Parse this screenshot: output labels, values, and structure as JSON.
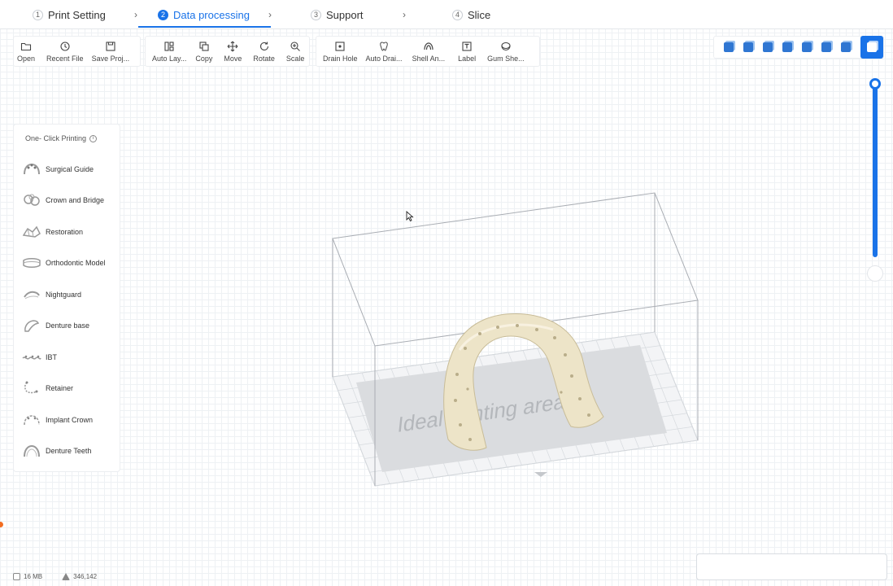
{
  "steps": [
    {
      "num": "1",
      "label": "Print Setting"
    },
    {
      "num": "2",
      "label": "Data processing"
    },
    {
      "num": "3",
      "label": "Support"
    },
    {
      "num": "4",
      "label": "Slice"
    }
  ],
  "active_step": 2,
  "chevron": "›",
  "toolbar": {
    "file": [
      {
        "label": "Open",
        "icon": "folder-icon"
      },
      {
        "label": "Recent File",
        "icon": "clock-icon"
      },
      {
        "label": "Save Proj...",
        "icon": "save-icon"
      }
    ],
    "edit": [
      {
        "label": "Auto Lay...",
        "icon": "layout-icon"
      },
      {
        "label": "Copy",
        "icon": "copy-icon"
      },
      {
        "label": "Move",
        "icon": "move-icon"
      },
      {
        "label": "Rotate",
        "icon": "rotate-icon"
      },
      {
        "label": "Scale",
        "icon": "scale-icon"
      }
    ],
    "tools": [
      {
        "label": "Drain Hole",
        "icon": "drain-hole-icon"
      },
      {
        "label": "Auto Drai...",
        "icon": "tooth-icon"
      },
      {
        "label": "Shell An...",
        "icon": "shell-icon"
      },
      {
        "label": "Label",
        "icon": "text-label-icon"
      },
      {
        "label": "Gum She...",
        "icon": "gum-icon"
      }
    ]
  },
  "views": [
    "view-iso-icon",
    "view-front-icon",
    "view-back-icon",
    "view-left-icon",
    "view-right-icon",
    "view-top-icon",
    "view-bottom-icon"
  ],
  "panel": {
    "title": "One- Click Printing",
    "info": "i",
    "items": [
      {
        "label": "Surgical Guide",
        "icon": "surgical-guide-icon"
      },
      {
        "label": "Crown and Bridge",
        "icon": "crown-bridge-icon"
      },
      {
        "label": "Restoration",
        "icon": "restoration-icon"
      },
      {
        "label": "Orthodontic Model",
        "icon": "orthodontic-icon"
      },
      {
        "label": "Nightguard",
        "icon": "nightguard-icon"
      },
      {
        "label": "Denture base",
        "icon": "denture-base-icon"
      },
      {
        "label": "IBT",
        "icon": "ibt-icon"
      },
      {
        "label": "Retainer",
        "icon": "retainer-icon"
      },
      {
        "label": "Implant Crown",
        "icon": "implant-crown-icon"
      },
      {
        "label": "Denture Teeth",
        "icon": "denture-teeth-icon"
      }
    ]
  },
  "viewport": {
    "plate_label": "Ideal printing area",
    "model_color": "#ede4c8"
  },
  "status": {
    "memory": "16 MB",
    "triangles": "346,142"
  }
}
